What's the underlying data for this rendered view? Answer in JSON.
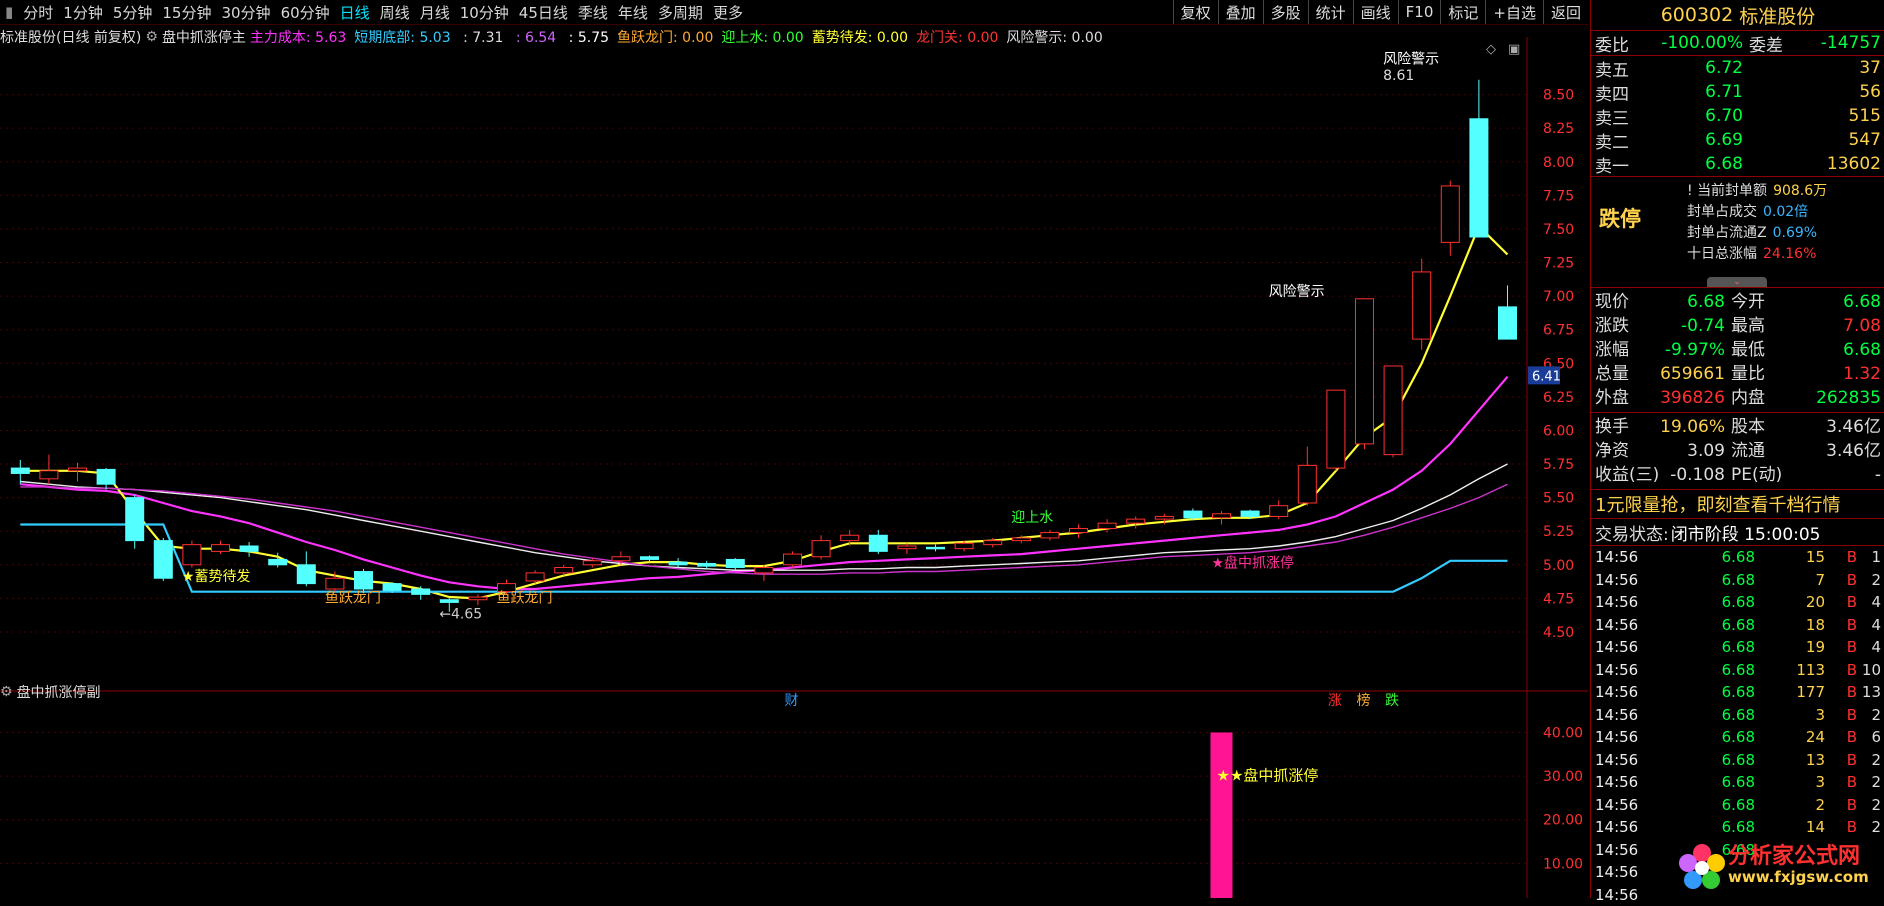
{
  "toolbar": {
    "timeframes": [
      "分时",
      "1分钟",
      "5分钟",
      "15分钟",
      "30分钟",
      "60分钟",
      "日线",
      "周线",
      "月线",
      "10分钟",
      "45日线",
      "季线",
      "年线",
      "多周期",
      "更多"
    ],
    "active": "日线",
    "tools": [
      "复权",
      "叠加",
      "多股",
      "统计",
      "画线",
      "F10",
      "标记",
      "+自选",
      "返回"
    ]
  },
  "indicator_line": {
    "stock": "标准股份(日线 前复权)",
    "formula": "盘中抓涨停主",
    "items": [
      {
        "label": "主力成本:",
        "value": "5.63",
        "color": "#ff33ff"
      },
      {
        "label": "短期底部:",
        "value": "5.03",
        "color": "#33ccff"
      },
      {
        "label": "",
        "value": ": 7.31",
        "color": "#dddddd"
      },
      {
        "label": "",
        "value": ": 6.54",
        "color": "#cc66ff"
      },
      {
        "label": "",
        "value": ": 5.75",
        "color": "#ffffff"
      },
      {
        "label": "鱼跃龙门:",
        "value": "0.00",
        "color": "#ffaa33"
      },
      {
        "label": "迎上水:",
        "value": "0.00",
        "color": "#33ff33"
      },
      {
        "label": "蓄势待发:",
        "value": "0.00",
        "color": "#ffff33"
      },
      {
        "label": "龙门关:",
        "value": "0.00",
        "color": "#ff3333"
      },
      {
        "label": "风险警示:",
        "value": "0.00",
        "color": "#dddddd"
      }
    ]
  },
  "chart_data": [
    {
      "type": "candlestick",
      "title": "",
      "ylim": [
        4.15,
        8.75
      ],
      "yticks": [
        "8.50",
        "8.25",
        "8.00",
        "7.75",
        "7.50",
        "7.25",
        "7.00",
        "6.75",
        "6.50",
        "6.25",
        "6.00",
        "5.75",
        "5.50",
        "5.25",
        "5.00",
        "4.75",
        "4.50"
      ],
      "current_price_label": "6.41",
      "candles": [
        {
          "o": 5.72,
          "h": 5.78,
          "l": 5.6,
          "c": 5.68
        },
        {
          "o": 5.64,
          "h": 5.82,
          "l": 5.6,
          "c": 5.7
        },
        {
          "o": 5.7,
          "h": 5.76,
          "l": 5.62,
          "c": 5.72
        },
        {
          "o": 5.71,
          "h": 5.72,
          "l": 5.56,
          "c": 5.6
        },
        {
          "o": 5.5,
          "h": 5.52,
          "l": 5.12,
          "c": 5.18
        },
        {
          "o": 5.18,
          "h": 5.2,
          "l": 4.88,
          "c": 4.9
        },
        {
          "o": 5.0,
          "h": 5.18,
          "l": 4.98,
          "c": 5.15
        },
        {
          "o": 5.1,
          "h": 5.18,
          "l": 5.08,
          "c": 5.15
        },
        {
          "o": 5.14,
          "h": 5.17,
          "l": 5.06,
          "c": 5.1
        },
        {
          "o": 5.04,
          "h": 5.09,
          "l": 4.98,
          "c": 5.0
        },
        {
          "o": 5.0,
          "h": 5.1,
          "l": 4.84,
          "c": 4.86
        },
        {
          "o": 4.82,
          "h": 4.95,
          "l": 4.8,
          "c": 4.9
        },
        {
          "o": 4.95,
          "h": 4.97,
          "l": 4.8,
          "c": 4.82
        },
        {
          "o": 4.86,
          "h": 4.87,
          "l": 4.79,
          "c": 4.81
        },
        {
          "o": 4.82,
          "h": 4.84,
          "l": 4.74,
          "c": 4.78
        },
        {
          "o": 4.74,
          "h": 4.76,
          "l": 4.65,
          "c": 4.72
        },
        {
          "o": 4.74,
          "h": 4.78,
          "l": 4.7,
          "c": 4.76
        },
        {
          "o": 4.8,
          "h": 4.89,
          "l": 4.78,
          "c": 4.86
        },
        {
          "o": 4.88,
          "h": 4.96,
          "l": 4.86,
          "c": 4.94
        },
        {
          "o": 4.94,
          "h": 5.0,
          "l": 4.92,
          "c": 4.98
        },
        {
          "o": 5.0,
          "h": 5.05,
          "l": 4.98,
          "c": 5.03
        },
        {
          "o": 5.03,
          "h": 5.1,
          "l": 5.0,
          "c": 5.06
        },
        {
          "o": 5.06,
          "h": 5.07,
          "l": 5.02,
          "c": 5.04
        },
        {
          "o": 5.02,
          "h": 5.05,
          "l": 4.98,
          "c": 5.0
        },
        {
          "o": 5.01,
          "h": 5.03,
          "l": 4.97,
          "c": 4.99
        },
        {
          "o": 5.04,
          "h": 5.05,
          "l": 4.96,
          "c": 4.98
        },
        {
          "o": 4.94,
          "h": 5.0,
          "l": 4.88,
          "c": 4.98
        },
        {
          "o": 5.0,
          "h": 5.1,
          "l": 4.98,
          "c": 5.08
        },
        {
          "o": 5.06,
          "h": 5.22,
          "l": 5.04,
          "c": 5.18
        },
        {
          "o": 5.18,
          "h": 5.26,
          "l": 5.14,
          "c": 5.22
        },
        {
          "o": 5.22,
          "h": 5.26,
          "l": 5.08,
          "c": 5.1
        },
        {
          "o": 5.12,
          "h": 5.16,
          "l": 5.08,
          "c": 5.14
        },
        {
          "o": 5.13,
          "h": 5.15,
          "l": 5.1,
          "c": 5.12
        },
        {
          "o": 5.12,
          "h": 5.18,
          "l": 5.1,
          "c": 5.16
        },
        {
          "o": 5.15,
          "h": 5.2,
          "l": 5.13,
          "c": 5.18
        },
        {
          "o": 5.18,
          "h": 5.22,
          "l": 5.16,
          "c": 5.2
        },
        {
          "o": 5.2,
          "h": 5.26,
          "l": 5.18,
          "c": 5.24
        },
        {
          "o": 5.24,
          "h": 5.3,
          "l": 5.2,
          "c": 5.27
        },
        {
          "o": 5.27,
          "h": 5.34,
          "l": 5.24,
          "c": 5.31
        },
        {
          "o": 5.31,
          "h": 5.36,
          "l": 5.27,
          "c": 5.34
        },
        {
          "o": 5.34,
          "h": 5.38,
          "l": 5.3,
          "c": 5.36
        },
        {
          "o": 5.4,
          "h": 5.42,
          "l": 5.33,
          "c": 5.35
        },
        {
          "o": 5.35,
          "h": 5.4,
          "l": 5.3,
          "c": 5.38
        },
        {
          "o": 5.4,
          "h": 5.41,
          "l": 5.34,
          "c": 5.36
        },
        {
          "o": 5.36,
          "h": 5.48,
          "l": 5.34,
          "c": 5.44
        },
        {
          "o": 5.46,
          "h": 5.88,
          "l": 5.44,
          "c": 5.74
        },
        {
          "o": 5.72,
          "h": 6.3,
          "l": 5.7,
          "c": 6.3
        },
        {
          "o": 5.9,
          "h": 6.98,
          "l": 5.86,
          "c": 6.98
        },
        {
          "o": 5.82,
          "h": 6.48,
          "l": 5.8,
          "c": 6.48
        },
        {
          "o": 6.68,
          "h": 7.28,
          "l": 6.6,
          "c": 7.18
        },
        {
          "o": 7.4,
          "h": 7.86,
          "l": 7.3,
          "c": 7.82
        },
        {
          "o": 8.32,
          "h": 8.61,
          "l": 7.44,
          "c": 7.44
        },
        {
          "o": 6.92,
          "h": 7.08,
          "l": 6.68,
          "c": 6.68
        }
      ],
      "series": [
        {
          "name": "主力成本",
          "color": "#ff33ff",
          "values": [
            5.6,
            5.58,
            5.56,
            5.55,
            5.52,
            5.46,
            5.4,
            5.36,
            5.31,
            5.24,
            5.17,
            5.11,
            5.04,
            4.98,
            4.92,
            4.87,
            4.84,
            4.82,
            4.82,
            4.84,
            4.86,
            4.88,
            4.9,
            4.91,
            4.93,
            4.95,
            4.96,
            4.98,
            5.0,
            5.02,
            5.03,
            5.04,
            5.05,
            5.06,
            5.07,
            5.08,
            5.1,
            5.12,
            5.14,
            5.16,
            5.18,
            5.2,
            5.22,
            5.24,
            5.26,
            5.3,
            5.36,
            5.46,
            5.56,
            5.7,
            5.9,
            6.15,
            6.4
          ]
        },
        {
          "name": "",
          "color": "#ffff33",
          "values": [
            5.7,
            5.7,
            5.7,
            5.68,
            5.4,
            5.14,
            5.12,
            5.12,
            5.1,
            5.06,
            4.96,
            4.92,
            4.88,
            4.86,
            4.82,
            4.76,
            4.75,
            4.8,
            4.86,
            4.92,
            4.96,
            5.0,
            5.02,
            5.02,
            5.0,
            4.99,
            4.99,
            5.03,
            5.1,
            5.16,
            5.16,
            5.16,
            5.16,
            5.17,
            5.18,
            5.2,
            5.22,
            5.24,
            5.27,
            5.3,
            5.32,
            5.34,
            5.35,
            5.35,
            5.37,
            5.46,
            5.7,
            5.95,
            6.1,
            6.5,
            7.0,
            7.52,
            7.31
          ]
        },
        {
          "name": "",
          "color": "#eeeeee",
          "values": [
            5.62,
            5.6,
            5.58,
            5.57,
            5.56,
            5.54,
            5.52,
            5.5,
            5.47,
            5.44,
            5.41,
            5.37,
            5.33,
            5.29,
            5.25,
            5.21,
            5.17,
            5.13,
            5.09,
            5.06,
            5.03,
            5.01,
            4.99,
            4.98,
            4.97,
            4.96,
            4.96,
            4.96,
            4.96,
            4.97,
            4.97,
            4.98,
            4.98,
            4.99,
            5.0,
            5.01,
            5.02,
            5.03,
            5.05,
            5.07,
            5.09,
            5.1,
            5.11,
            5.12,
            5.14,
            5.17,
            5.21,
            5.27,
            5.33,
            5.42,
            5.52,
            5.64,
            5.75
          ]
        },
        {
          "name": "",
          "color": "#cc33cc",
          "values": [
            5.58,
            5.58,
            5.57,
            5.57,
            5.56,
            5.55,
            5.53,
            5.51,
            5.49,
            5.46,
            5.43,
            5.4,
            5.36,
            5.32,
            5.28,
            5.24,
            5.2,
            5.16,
            5.12,
            5.08,
            5.05,
            5.02,
            4.99,
            4.97,
            4.95,
            4.94,
            4.93,
            4.93,
            4.93,
            4.94,
            4.94,
            4.95,
            4.95,
            4.96,
            4.97,
            4.98,
            4.99,
            5.0,
            5.02,
            5.04,
            5.06,
            5.07,
            5.08,
            5.09,
            5.11,
            5.14,
            5.17,
            5.22,
            5.28,
            5.35,
            5.42,
            5.5,
            5.6
          ]
        },
        {
          "name": "短期底部",
          "color": "#33ccff",
          "values": [
            5.3,
            5.3,
            5.3,
            5.3,
            5.3,
            5.3,
            4.8,
            4.8,
            4.8,
            4.8,
            4.8,
            4.8,
            4.8,
            4.8,
            4.8,
            4.8,
            4.8,
            4.8,
            4.8,
            4.8,
            4.8,
            4.8,
            4.8,
            4.8,
            4.8,
            4.8,
            4.8,
            4.8,
            4.8,
            4.8,
            4.8,
            4.8,
            4.8,
            4.8,
            4.8,
            4.8,
            4.8,
            4.8,
            4.8,
            4.8,
            4.8,
            4.8,
            4.8,
            4.8,
            4.8,
            4.8,
            4.8,
            4.8,
            4.8,
            4.9,
            5.03,
            5.03,
            5.03
          ]
        }
      ],
      "annotations": [
        {
          "text": "★蓄势待发",
          "color": "#ffff33",
          "i": 6,
          "y": 4.88
        },
        {
          "text": "鱼跃龙门",
          "color": "#ffaa33",
          "i": 11,
          "y": 4.72
        },
        {
          "text": "鱼跃龙门",
          "color": "#ffaa33",
          "i": 17,
          "y": 4.72
        },
        {
          "text": "←4.65",
          "color": "#cccccc",
          "i": 15,
          "y": 4.6
        },
        {
          "text": "迎上水",
          "color": "#33ff33",
          "i": 35,
          "y": 5.32
        },
        {
          "text": "★盘中抓涨停",
          "color": "#ff3399",
          "i": 42,
          "y": 4.98
        },
        {
          "text": "风险警示",
          "color": "#ffffff",
          "i": 44,
          "y": 7.0
        },
        {
          "text": "风险警示",
          "color": "#ffffff",
          "i": 48,
          "y": 8.73
        },
        {
          "text": "8.61",
          "color": "#dddddd",
          "i": 48,
          "y": 8.61
        }
      ],
      "badges": [
        {
          "text": "财",
          "color": "#3399ff",
          "i": 27
        },
        {
          "text": "涨",
          "color": "#ff3030",
          "i": 46
        },
        {
          "text": "榜",
          "color": "#ffaa33",
          "i": 47
        },
        {
          "text": "跌",
          "color": "#33ff33",
          "i": 48
        }
      ]
    },
    {
      "type": "bar",
      "title": "盘中抓涨停副",
      "ylim": [
        0,
        44
      ],
      "yticks": [
        "40.00",
        "30.00",
        "20.00",
        "10.00"
      ],
      "values": [
        {
          "i": 42,
          "v": 40
        }
      ],
      "color": "#ff1493",
      "label": "★★盘中抓涨停"
    }
  ],
  "right_panel": {
    "code": "600302",
    "name": "标准股份",
    "weibi": {
      "label": "委比",
      "value": "-100.00%",
      "label2": "委差",
      "value2": "-14757"
    },
    "sells": [
      {
        "label": "卖五",
        "price": "6.72",
        "vol": "37"
      },
      {
        "label": "卖四",
        "price": "6.71",
        "vol": "56"
      },
      {
        "label": "卖三",
        "price": "6.70",
        "vol": "515"
      },
      {
        "label": "卖二",
        "price": "6.69",
        "vol": "547"
      },
      {
        "label": "卖一",
        "price": "6.68",
        "vol": "13602"
      }
    ],
    "limit_status": "跌停",
    "seal": [
      {
        "label": "当前封单额",
        "value": "908.6万"
      },
      {
        "label": "封单占成交",
        "value": "0.02倍"
      },
      {
        "label": "封单占流通Z",
        "value": "0.69%"
      },
      {
        "label": "十日总涨幅",
        "value": "24.16%"
      }
    ],
    "quote": [
      {
        "l1": "现价",
        "v1": "6.68",
        "c1": "#00ff40",
        "l2": "今开",
        "v2": "6.68",
        "c2": "#00ff40"
      },
      {
        "l1": "涨跌",
        "v1": "-0.74",
        "c1": "#00ff40",
        "l2": "最高",
        "v2": "7.08",
        "c2": "#ff3030"
      },
      {
        "l1": "涨幅",
        "v1": "-9.97%",
        "c1": "#00ff40",
        "l2": "最低",
        "v2": "6.68",
        "c2": "#00ff40"
      },
      {
        "l1": "总量",
        "v1": "659661",
        "c1": "#ffd24d",
        "l2": "量比",
        "v2": "1.32",
        "c2": "#ff3030"
      },
      {
        "l1": "外盘",
        "v1": "396826",
        "c1": "#ff3030",
        "l2": "内盘",
        "v2": "262835",
        "c2": "#00ff40"
      }
    ],
    "quote2": [
      {
        "l1": "换手",
        "v1": "19.06%",
        "c1": "#ffd24d",
        "l2": "股本",
        "v2": "3.46亿",
        "c2": "#dddddd"
      },
      {
        "l1": "净资",
        "v1": "3.09",
        "c1": "#dddddd",
        "l2": "流通",
        "v2": "3.46亿",
        "c2": "#dddddd"
      },
      {
        "l1": "收益(三)",
        "v1": "-0.108",
        "c1": "#dddddd",
        "l2": "PE(动)",
        "v2": "-",
        "c2": "#dddddd"
      }
    ],
    "ad": "1元限量抢，即刻查看千档行情",
    "trade_status_label": "交易状态:",
    "trade_status": "闭市阶段 15:00:05",
    "ticks": [
      {
        "t": "14:56",
        "p": "6.68",
        "v": "15",
        "b": "B",
        "n": "1"
      },
      {
        "t": "14:56",
        "p": "6.68",
        "v": "7",
        "b": "B",
        "n": "2"
      },
      {
        "t": "14:56",
        "p": "6.68",
        "v": "20",
        "b": "B",
        "n": "4"
      },
      {
        "t": "14:56",
        "p": "6.68",
        "v": "18",
        "b": "B",
        "n": "4"
      },
      {
        "t": "14:56",
        "p": "6.68",
        "v": "19",
        "b": "B",
        "n": "4"
      },
      {
        "t": "14:56",
        "p": "6.68",
        "v": "113",
        "b": "B",
        "n": "10"
      },
      {
        "t": "14:56",
        "p": "6.68",
        "v": "177",
        "b": "B",
        "n": "13"
      },
      {
        "t": "14:56",
        "p": "6.68",
        "v": "3",
        "b": "B",
        "n": "2"
      },
      {
        "t": "14:56",
        "p": "6.68",
        "v": "24",
        "b": "B",
        "n": "6"
      },
      {
        "t": "14:56",
        "p": "6.68",
        "v": "13",
        "b": "B",
        "n": "2"
      },
      {
        "t": "14:56",
        "p": "6.68",
        "v": "3",
        "b": "B",
        "n": "2"
      },
      {
        "t": "14:56",
        "p": "6.68",
        "v": "2",
        "b": "B",
        "n": "2"
      },
      {
        "t": "14:56",
        "p": "6.68",
        "v": "14",
        "b": "B",
        "n": "2"
      },
      {
        "t": "14:56",
        "p": "6.68",
        "v": "",
        "b": "",
        "n": ""
      },
      {
        "t": "14:56",
        "p": "",
        "v": "",
        "b": "",
        "n": ""
      },
      {
        "t": "14:56",
        "p": "",
        "v": "",
        "b": "",
        "n": ""
      }
    ],
    "watermark": {
      "t1": "分析家公式网",
      "t2": "www.fxjgsw.com"
    }
  }
}
